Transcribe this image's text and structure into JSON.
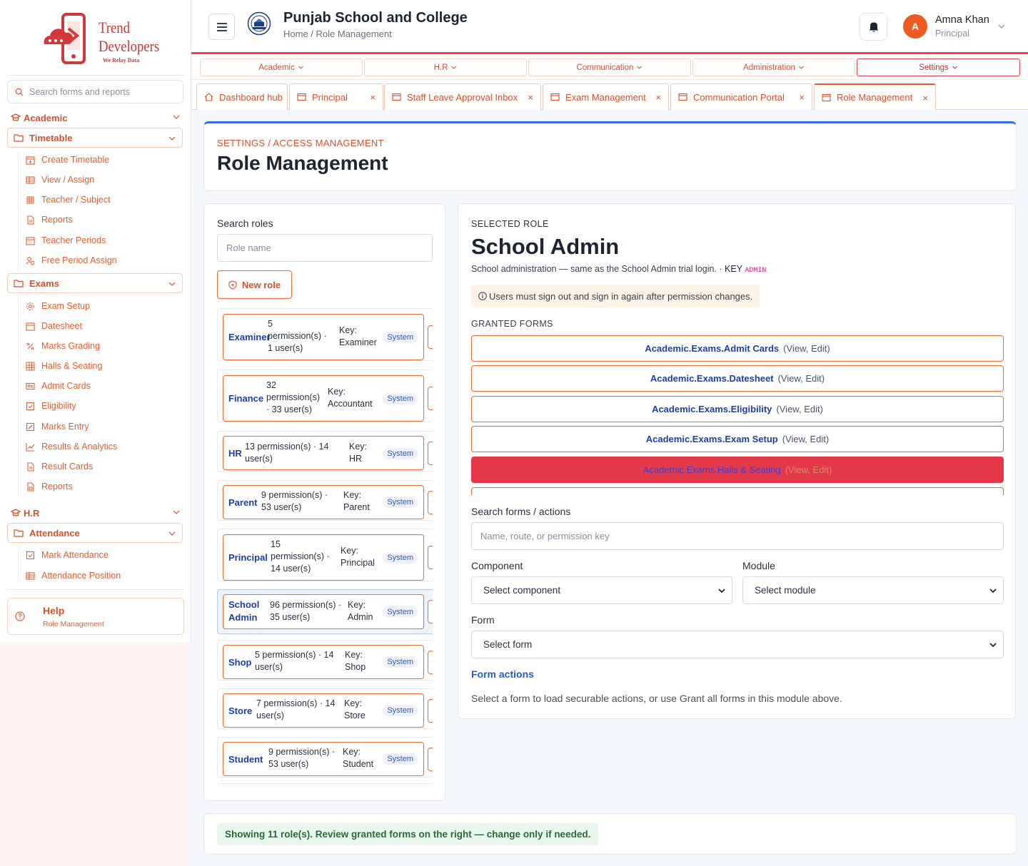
{
  "brand": {
    "line1": "Trend",
    "line2": "Developers",
    "tagline": "We Relay Data"
  },
  "sidebar": {
    "search_placeholder": "Search forms and reports",
    "academic": {
      "label": "Academic",
      "timetable": {
        "label": "Timetable",
        "items": [
          "Create Timetable",
          "View / Assign",
          "Teacher / Subject",
          "Reports",
          "Teacher Periods",
          "Free Period Assign"
        ]
      },
      "exams": {
        "label": "Exams",
        "items": [
          "Exam Setup",
          "Datesheet",
          "Marks Grading",
          "Halls & Seating",
          "Admit Cards",
          "Eligibility",
          "Marks Entry",
          "Results & Analytics",
          "Result Cards",
          "Reports"
        ]
      }
    },
    "hr": {
      "label": "H.R",
      "attendance": {
        "label": "Attendance",
        "items": [
          "Mark Attendance",
          "Attendance Position"
        ]
      }
    },
    "help": {
      "title": "Help",
      "subtitle": "Role Management"
    }
  },
  "header": {
    "school_name": "Punjab School and College",
    "breadcrumb": "Home / Role Management",
    "user": {
      "initial": "A",
      "name": "Amna Khan",
      "role": "Principal"
    }
  },
  "menu": [
    "Academic",
    "H.R",
    "Communication",
    "Administration",
    "Settings"
  ],
  "tabs": [
    {
      "label": "Dashboard hub",
      "closable": false
    },
    {
      "label": "Principal",
      "closable": true
    },
    {
      "label": "Staff Leave Approval Inbox",
      "closable": true
    },
    {
      "label": "Exam Management",
      "closable": true
    },
    {
      "label": "Communication Portal",
      "closable": true
    },
    {
      "label": "Role Management",
      "closable": true
    }
  ],
  "close_glyph": "×",
  "page": {
    "eyebrow": "SETTINGS / ACCESS MANAGEMENT",
    "title": "Role Management"
  },
  "roles_panel": {
    "search_label": "Search roles",
    "search_placeholder": "Role name",
    "new_role_label": "New role",
    "badge_label": "System",
    "roles": [
      {
        "name": "Examiner",
        "meta": [
          "5",
          "permission(s) ·",
          "1 user(s)"
        ],
        "key": [
          "Key:",
          "Examiner"
        ]
      },
      {
        "name": "Finance",
        "meta": [
          "32",
          "permission(s)",
          "· 33 user(s)"
        ],
        "key": [
          "Key:",
          "Accountant"
        ]
      },
      {
        "name": "HR",
        "meta": [
          "13 permission(s) · 14",
          "user(s)"
        ],
        "key": [
          "Key:",
          "HR"
        ]
      },
      {
        "name": "Parent",
        "meta": [
          "9 permission(s) ·",
          "53 user(s)"
        ],
        "key": [
          "Key:",
          "Parent"
        ]
      },
      {
        "name": "Principal",
        "meta": [
          "15",
          "permission(s) ·",
          "14 user(s)"
        ],
        "key": [
          "Key:",
          "Principal"
        ]
      },
      {
        "name": "School Admin",
        "name_lines": [
          "School",
          "Admin"
        ],
        "meta": [
          "96 permission(s) ·",
          "35 user(s)"
        ],
        "key": [
          "Key:",
          "Admin"
        ],
        "selected": true
      },
      {
        "name": "Shop",
        "meta": [
          "5 permission(s) · 14",
          "user(s)"
        ],
        "key": [
          "Key:",
          "Shop"
        ]
      },
      {
        "name": "Store",
        "meta": [
          "7 permission(s) · 14",
          "user(s)"
        ],
        "key": [
          "Key:",
          "Store"
        ]
      },
      {
        "name": "Student",
        "meta": [
          "9 permission(s) ·",
          "53 user(s)"
        ],
        "key": [
          "Key:",
          "Student"
        ]
      }
    ]
  },
  "role_detail": {
    "eyebrow": "SELECTED ROLE",
    "name": "School Admin",
    "description": "School administration — same as the School Admin trial login. ·",
    "key_label": "KEY",
    "key_value": "ADMIN",
    "notice": "Users must sign out and sign in again after permission changes.",
    "granted_label": "GRANTED FORMS",
    "granted_forms": [
      {
        "name": "Academic.Exams.Admit Cards",
        "actions": "(View, Edit)"
      },
      {
        "name": "Academic.Exams.Datesheet",
        "actions": "(View, Edit)"
      },
      {
        "name": "Academic.Exams.Eligibility",
        "actions": "(View, Edit)"
      },
      {
        "name": "Academic.Exams.Exam Setup",
        "actions": "(View, Edit)"
      },
      {
        "name": "Academic.Exams.Halls & Seating",
        "actions": "(View, Edit)",
        "highlight": true
      }
    ],
    "search_label": "Search forms / actions",
    "search_placeholder": "Name, route, or permission key",
    "component_label": "Component",
    "component_value": "Select component",
    "module_label": "Module",
    "module_value": "Select module",
    "form_label": "Form",
    "form_value": "Select form",
    "form_actions_title": "Form actions",
    "form_actions_desc": "Select a form to load securable actions, or use Grant all forms in this module above."
  },
  "footer_message": "Showing 11 role(s). Review granted forms on the right — change only if needed.",
  "colors": {
    "accent": "#ef5a23",
    "primary_text": "#1d3fa8",
    "danger": "#e5394a",
    "topline": "#2f6fe0"
  }
}
